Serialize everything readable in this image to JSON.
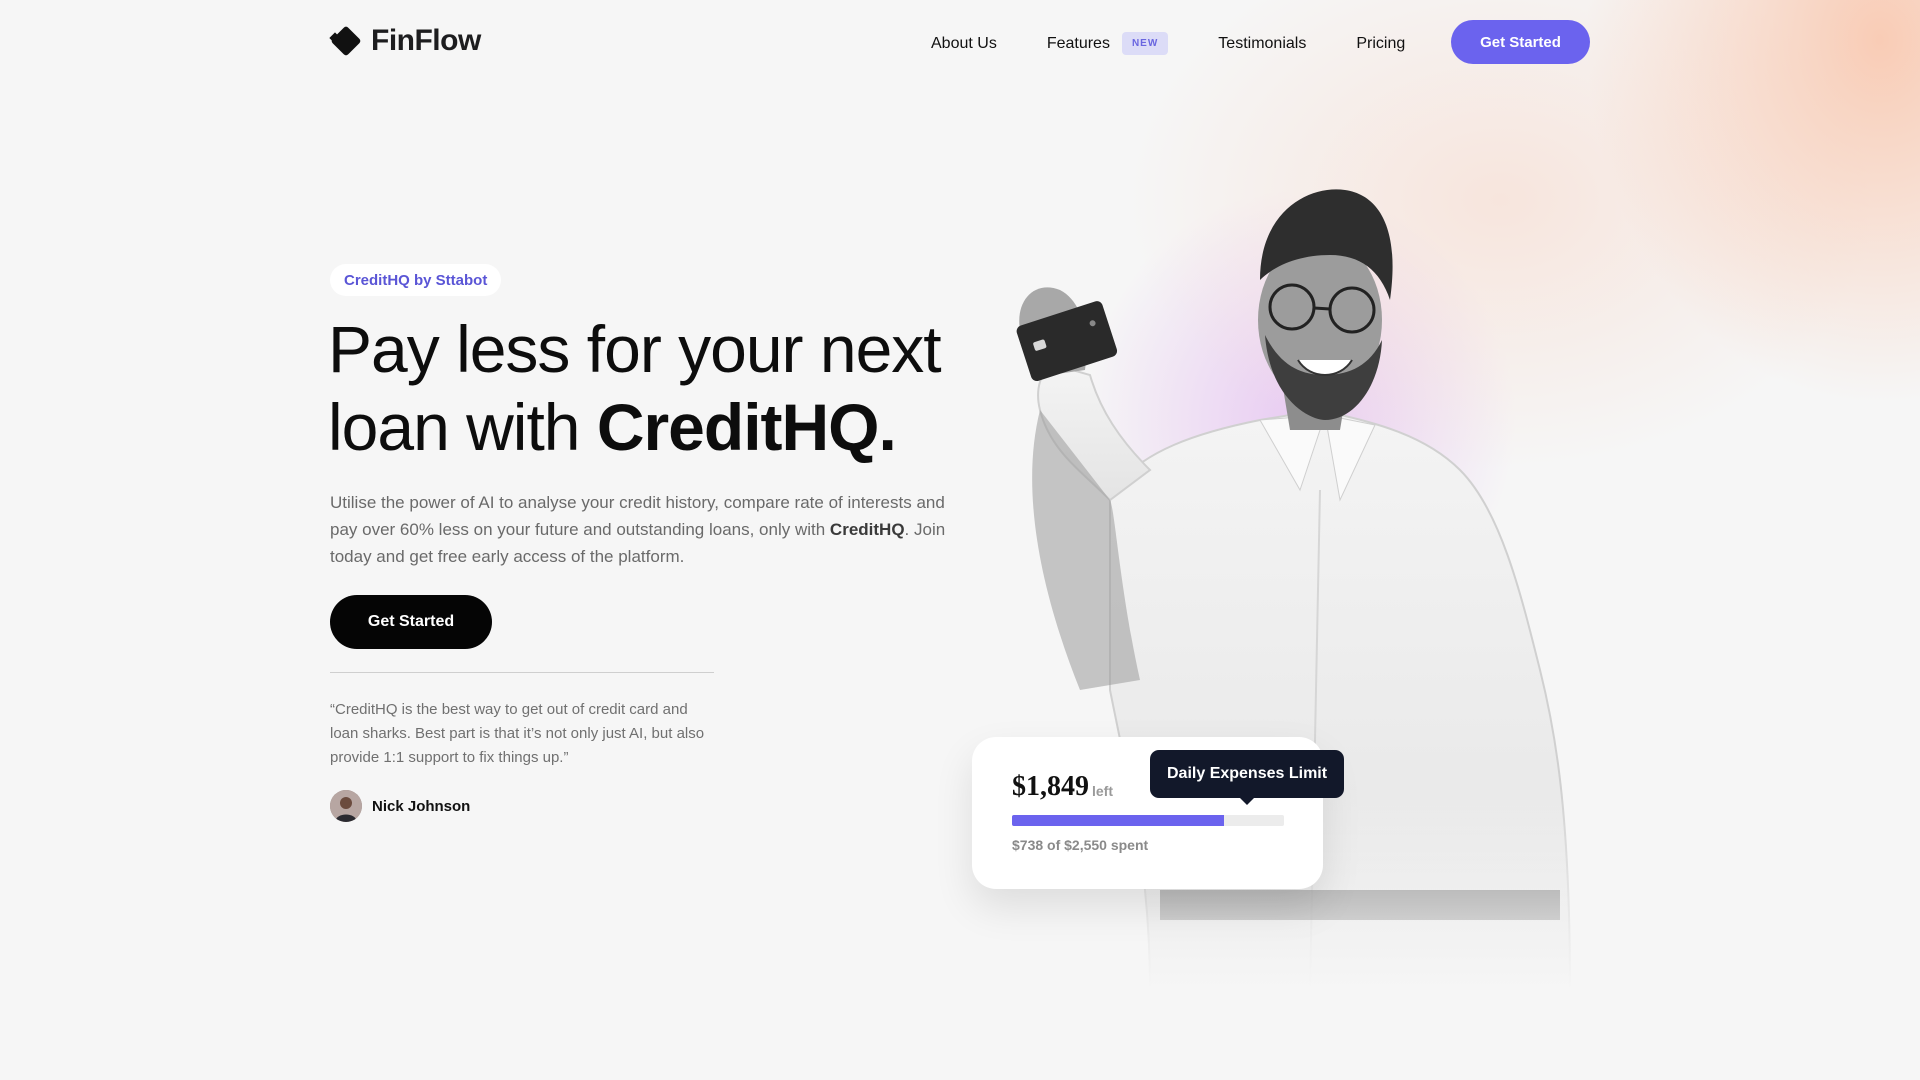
{
  "nav": {
    "brand": "FinFlow",
    "links": [
      "About Us",
      "Features",
      "Testimonials",
      "Pricing"
    ],
    "features_badge": "NEW",
    "cta": "Get Started"
  },
  "hero": {
    "pill": "CreditHQ by Sttabot",
    "headline_part1": "Pay less for your next loan with ",
    "headline_bold": "CreditHQ.",
    "description_part1": "Utilise the power of AI to analyse your credit history, compare rate of interests and pay over 60% less on your future and outstanding loans, only with ",
    "description_bold": "CreditHQ",
    "description_part2": ". Join today and get free early access of the platform.",
    "cta": "Get Started",
    "quote": "“CreditHQ is the best way to get out of credit card and loan sharks. Best part is that it’s not only just AI, but also provide 1:1 support to fix things up.”",
    "author": "Nick Johnson"
  },
  "balance_card": {
    "amount": "$1,849",
    "amount_suffix": "left",
    "spent_text": "$738 of $2,550 spent",
    "progress_fraction": 0.78,
    "tooltip": "Daily Expenses Limit"
  },
  "colors": {
    "accent": "#6b63ee",
    "dark": "#050505",
    "tooltip_bg": "#12182a"
  }
}
